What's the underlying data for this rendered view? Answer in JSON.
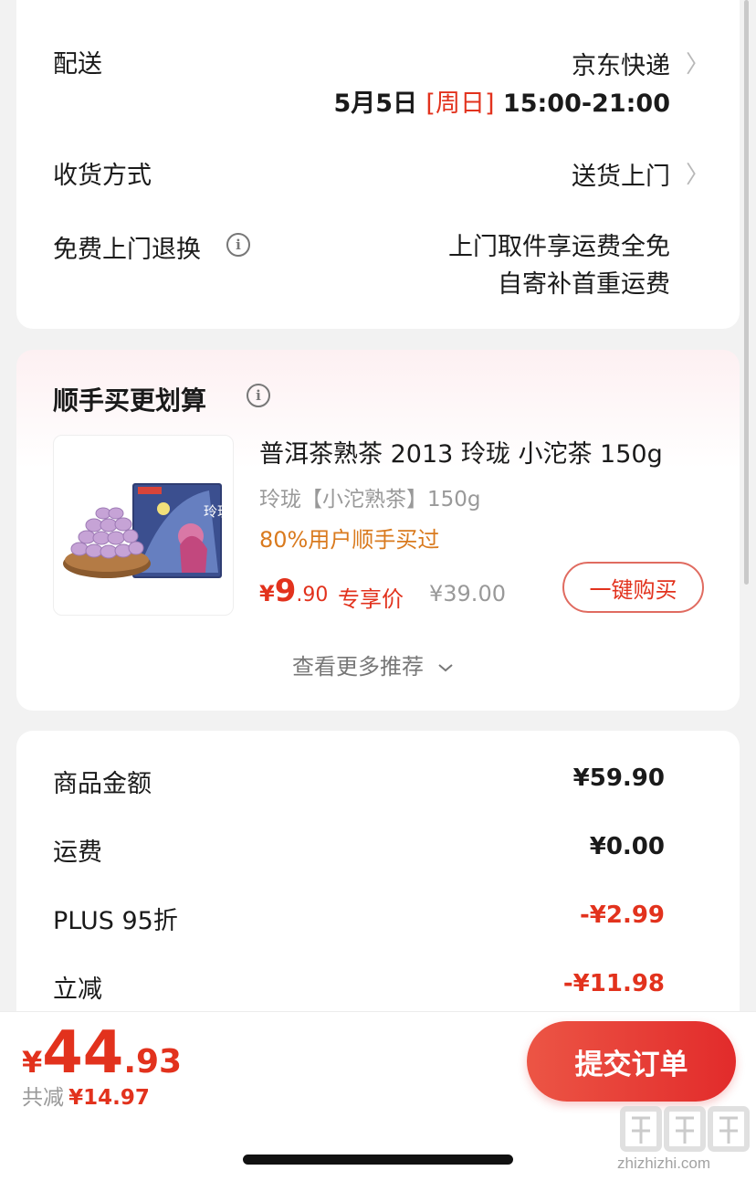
{
  "delivery": {
    "label": "配送",
    "carrier": "京东快递",
    "date": "5月5日",
    "weekday": "[周日]",
    "time": "15:00-21:00"
  },
  "receive": {
    "label": "收货方式",
    "value": "送货上门"
  },
  "free_return": {
    "label": "免费上门退换",
    "line1": "上门取件享运费全免",
    "line2": "自寄补首重运费"
  },
  "recommend": {
    "title": "顺手买更划算",
    "product": {
      "name": "普洱茶熟茶 2013 玲珑 小沱茶 150g",
      "spec": "玲珑【小沱熟茶】150g",
      "hint": "80%用户顺手买过",
      "price_symbol": "¥",
      "price_int": "9",
      "price_dec": ".90",
      "price_tag": "专享价",
      "orig_price": "¥39.00",
      "image_text": "玲珑",
      "buy_label": "一键购买"
    },
    "more_label": "查看更多推荐",
    "more_icon": "chevron-down-icon"
  },
  "summary": {
    "rows": [
      {
        "label": "商品金额",
        "value": "¥59.90",
        "color": "#1a1a1a"
      },
      {
        "label": "运费",
        "value": "¥0.00",
        "color": "#1a1a1a"
      },
      {
        "label": "PLUS 95折",
        "value": "-¥2.99",
        "color": "#e2321d"
      },
      {
        "label": "立减",
        "value": "-¥11.98",
        "color": "#e2321d"
      }
    ]
  },
  "bottom": {
    "currency": "¥",
    "total_int": "44",
    "total_dec": ".93",
    "saved_label": "共减",
    "saved_value": "¥14.97",
    "submit_label": "提交订单"
  },
  "watermark": {
    "site": "zhizhizhi.com"
  },
  "colors": {
    "accent_red": "#e2321d",
    "hint_orange": "#d97a1e",
    "background": "#f2f2f2"
  }
}
